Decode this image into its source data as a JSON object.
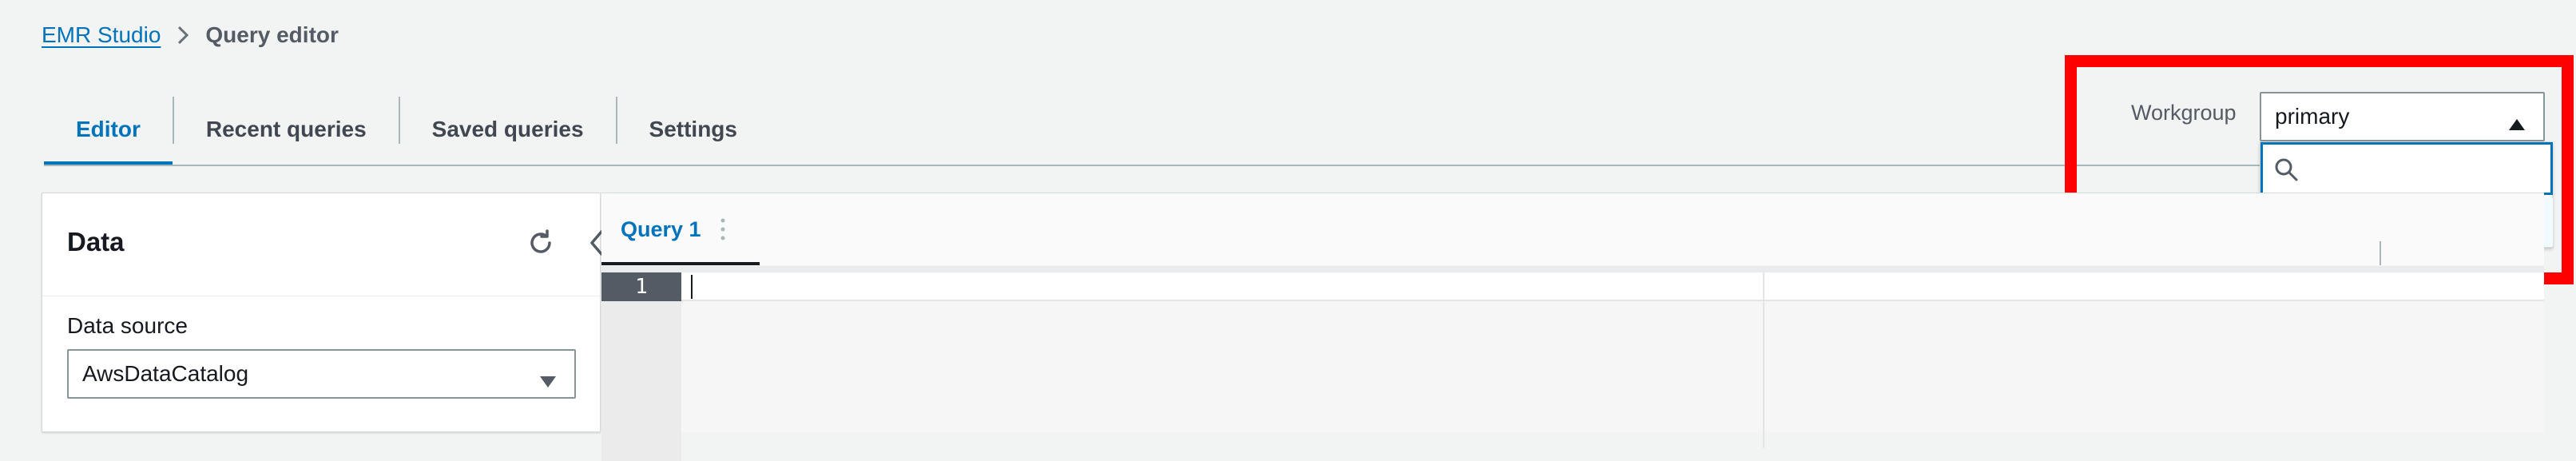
{
  "breadcrumb": {
    "root": "EMR Studio",
    "current": "Query editor"
  },
  "tabs": [
    {
      "label": "Editor",
      "active": true
    },
    {
      "label": "Recent queries",
      "active": false
    },
    {
      "label": "Saved queries",
      "active": false
    },
    {
      "label": "Settings",
      "active": false
    }
  ],
  "workgroup": {
    "label": "Workgroup",
    "selected": "primary",
    "search_placeholder": "",
    "options": [
      {
        "label": "primary",
        "selected": true
      }
    ]
  },
  "data_panel": {
    "title": "Data",
    "data_source_label": "Data source",
    "data_source_value": "AwsDataCatalog"
  },
  "editor": {
    "query_tab": "Query 1",
    "line_number": "1"
  },
  "colors": {
    "accent": "#0073bb",
    "highlight": "#ff0000"
  }
}
